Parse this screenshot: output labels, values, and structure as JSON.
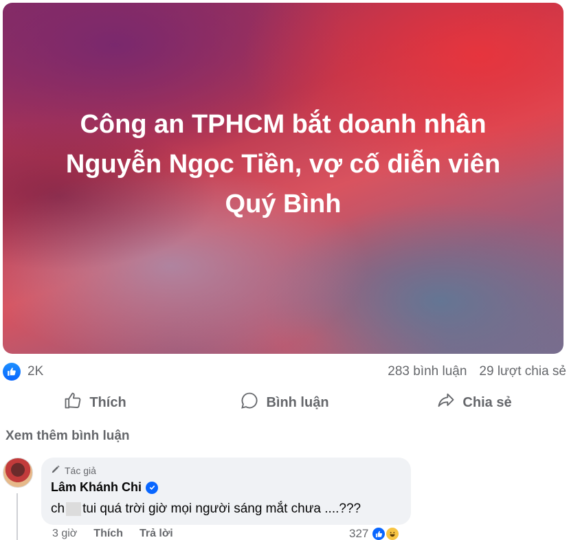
{
  "post": {
    "lines": [
      "Công an TPHCM bắt doanh nhân",
      "Nguyễn Ngọc Tiền, vợ cố diễn viên",
      "Quý Bình"
    ]
  },
  "reactions": {
    "count": "2K",
    "comments": "283 bình luận",
    "shares": "29 lượt chia sẻ"
  },
  "actions": {
    "like": "Thích",
    "comment": "Bình luận",
    "share": "Chia sẻ"
  },
  "more_comments": "Xem thêm bình luận",
  "comment": {
    "author_tag": "Tác giả",
    "author_name": "Lâm Khánh Chi",
    "text_before": "ch",
    "text_after": "tui quá trời giờ mọi người sáng mắt chưa ....???",
    "time": "3 giờ",
    "like": "Thích",
    "reply": "Trả lời",
    "reaction_count": "327"
  },
  "colors": {
    "accent": "#0866ff",
    "muted": "#65676b",
    "bubble": "#f0f2f5"
  }
}
